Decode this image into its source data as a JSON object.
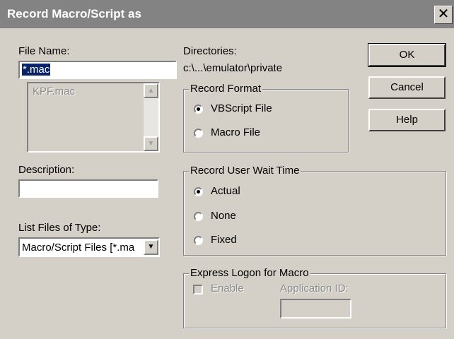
{
  "window": {
    "title": "Record Macro/Script as",
    "close_glyph": "✕"
  },
  "file_name": {
    "label": "File Name:",
    "value": "*.mac",
    "files": [
      "KPF.mac"
    ]
  },
  "directories": {
    "label": "Directories:",
    "path": "c:\\...\\emulator\\private"
  },
  "description": {
    "label": "Description:",
    "value": ""
  },
  "list_files": {
    "label": "List Files of Type:",
    "value": "Macro/Script Files [*.ma"
  },
  "record_format": {
    "legend": "Record Format",
    "options": [
      {
        "label": "VBScript File",
        "checked": true
      },
      {
        "label": "Macro File",
        "checked": false
      }
    ]
  },
  "wait_time": {
    "legend": "Record User Wait Time",
    "options": [
      {
        "label": "Actual",
        "checked": true
      },
      {
        "label": "None",
        "checked": false
      },
      {
        "label": "Fixed",
        "checked": false
      }
    ]
  },
  "express_logon": {
    "legend": "Express Logon for Macro",
    "enable_label": "Enable",
    "app_id_label": "Application ID:",
    "app_id_value": ""
  },
  "buttons": {
    "ok": "OK",
    "cancel": "Cancel",
    "help": "Help"
  },
  "icons": {
    "scroll_up": "▲",
    "scroll_down": "▼",
    "dropdown": "▼"
  }
}
